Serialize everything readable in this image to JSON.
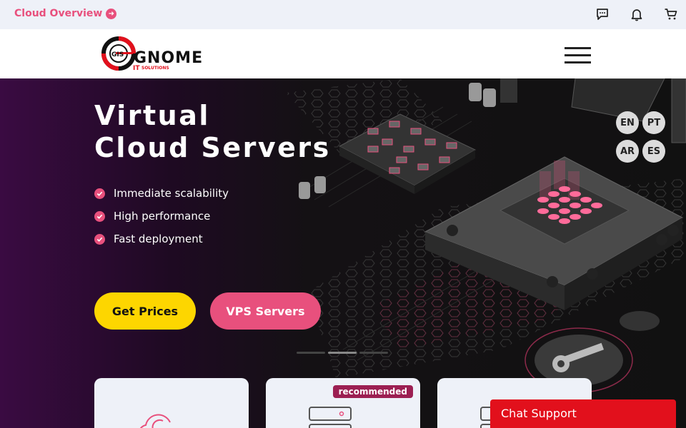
{
  "topbar": {
    "overview_link": "Cloud Overview",
    "icons": [
      "chat-icon",
      "bell-icon",
      "cart-icon"
    ]
  },
  "header": {
    "logo": {
      "small_text": "GIS",
      "brand": "GNOME",
      "sub_it": "IT",
      "sub_solutions": "SOLUTIONS"
    },
    "menu_icon": "hamburger-icon"
  },
  "hero": {
    "title_line1": "Virtual",
    "title_line2": "Cloud Servers",
    "features": [
      "Immediate scalability",
      "High performance",
      "Fast deployment"
    ],
    "primary_button": "Get Prices",
    "secondary_button": "VPS Servers",
    "slides": {
      "count": 3,
      "active_index": 1
    }
  },
  "languages": [
    "EN",
    "PT",
    "AR",
    "ES"
  ],
  "cards": [
    {
      "icon": "cloud-icon",
      "badge": ""
    },
    {
      "icon": "server-icon",
      "badge": "recommended"
    },
    {
      "icon": "server-stack-icon",
      "badge": ""
    }
  ],
  "chat": {
    "label": "Chat Support"
  },
  "colors": {
    "accent": "#e8507d",
    "yellow": "#fdd600",
    "badge": "#9c1f52",
    "chat": "#e2101c",
    "topbar": "#eef1f8"
  }
}
